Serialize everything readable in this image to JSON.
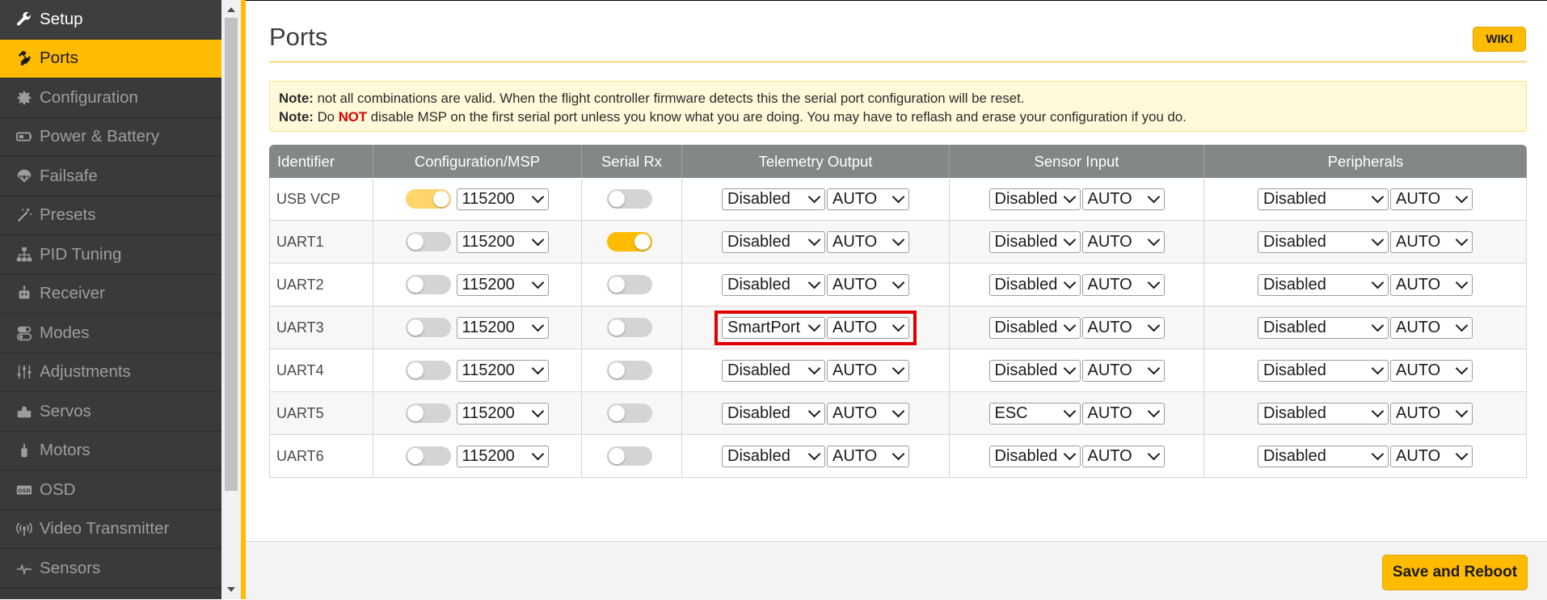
{
  "sidebar": {
    "items": [
      {
        "label": "Setup",
        "icon": "wrench-icon",
        "state": "top"
      },
      {
        "label": "Ports",
        "icon": "plug-icon",
        "state": "active"
      },
      {
        "label": "Configuration",
        "icon": "gear-icon",
        "state": ""
      },
      {
        "label": "Power & Battery",
        "icon": "battery-icon",
        "state": ""
      },
      {
        "label": "Failsafe",
        "icon": "parachute-icon",
        "state": ""
      },
      {
        "label": "Presets",
        "icon": "magic-wand-icon",
        "state": ""
      },
      {
        "label": "PID Tuning",
        "icon": "sitemap-icon",
        "state": ""
      },
      {
        "label": "Receiver",
        "icon": "robot-icon",
        "state": ""
      },
      {
        "label": "Modes",
        "icon": "toggles-icon",
        "state": ""
      },
      {
        "label": "Adjustments",
        "icon": "sliders-icon",
        "state": ""
      },
      {
        "label": "Servos",
        "icon": "servo-icon",
        "state": ""
      },
      {
        "label": "Motors",
        "icon": "motor-icon",
        "state": ""
      },
      {
        "label": "OSD",
        "icon": "osd-icon",
        "state": ""
      },
      {
        "label": "Video Transmitter",
        "icon": "broadcast-icon",
        "state": ""
      },
      {
        "label": "Sensors",
        "icon": "pulse-icon",
        "state": ""
      }
    ]
  },
  "header": {
    "title": "Ports",
    "wiki_label": "WIKI"
  },
  "note": {
    "label": "Note:",
    "line1": "not all combinations are valid. When the flight controller firmware detects this the serial port configuration will be reset.",
    "line2_pre": "Do",
    "line2_not": "NOT",
    "line2_post": "disable MSP on the first serial port unless you know what you are doing. You may have to reflash and erase your configuration if you do."
  },
  "table": {
    "headers": [
      "Identifier",
      "Configuration/MSP",
      "Serial Rx",
      "Telemetry Output",
      "Sensor Input",
      "Peripherals"
    ],
    "rows": [
      {
        "id": "USB VCP",
        "msp": "on-light",
        "baud": "115200",
        "rx": "off",
        "telemetry": "Disabled",
        "tel_baud": "AUTO",
        "sensor": "Disabled",
        "sens_baud": "AUTO",
        "periph": "Disabled",
        "per_baud": "AUTO"
      },
      {
        "id": "UART1",
        "msp": "off",
        "baud": "115200",
        "rx": "on",
        "telemetry": "Disabled",
        "tel_baud": "AUTO",
        "sensor": "Disabled",
        "sens_baud": "AUTO",
        "periph": "Disabled",
        "per_baud": "AUTO"
      },
      {
        "id": "UART2",
        "msp": "off",
        "baud": "115200",
        "rx": "off",
        "telemetry": "Disabled",
        "tel_baud": "AUTO",
        "sensor": "Disabled",
        "sens_baud": "AUTO",
        "periph": "Disabled",
        "per_baud": "AUTO"
      },
      {
        "id": "UART3",
        "msp": "off",
        "baud": "115200",
        "rx": "off",
        "telemetry": "SmartPort",
        "tel_baud": "AUTO",
        "sensor": "Disabled",
        "sens_baud": "AUTO",
        "periph": "Disabled",
        "per_baud": "AUTO",
        "highlight": true
      },
      {
        "id": "UART4",
        "msp": "off",
        "baud": "115200",
        "rx": "off",
        "telemetry": "Disabled",
        "tel_baud": "AUTO",
        "sensor": "Disabled",
        "sens_baud": "AUTO",
        "periph": "Disabled",
        "per_baud": "AUTO"
      },
      {
        "id": "UART5",
        "msp": "off",
        "baud": "115200",
        "rx": "off",
        "telemetry": "Disabled",
        "tel_baud": "AUTO",
        "sensor": "ESC",
        "sens_baud": "AUTO",
        "periph": "Disabled",
        "per_baud": "AUTO"
      },
      {
        "id": "UART6",
        "msp": "off",
        "baud": "115200",
        "rx": "off",
        "telemetry": "Disabled",
        "tel_baud": "AUTO",
        "sensor": "Disabled",
        "sens_baud": "AUTO",
        "periph": "Disabled",
        "per_baud": "AUTO"
      }
    ]
  },
  "footer": {
    "save_label": "Save and Reboot"
  },
  "colors": {
    "accent": "#ffbb00",
    "sidebar_bg": "#3a3a3a",
    "highlight": "#e00000",
    "header_bg": "#828885"
  }
}
